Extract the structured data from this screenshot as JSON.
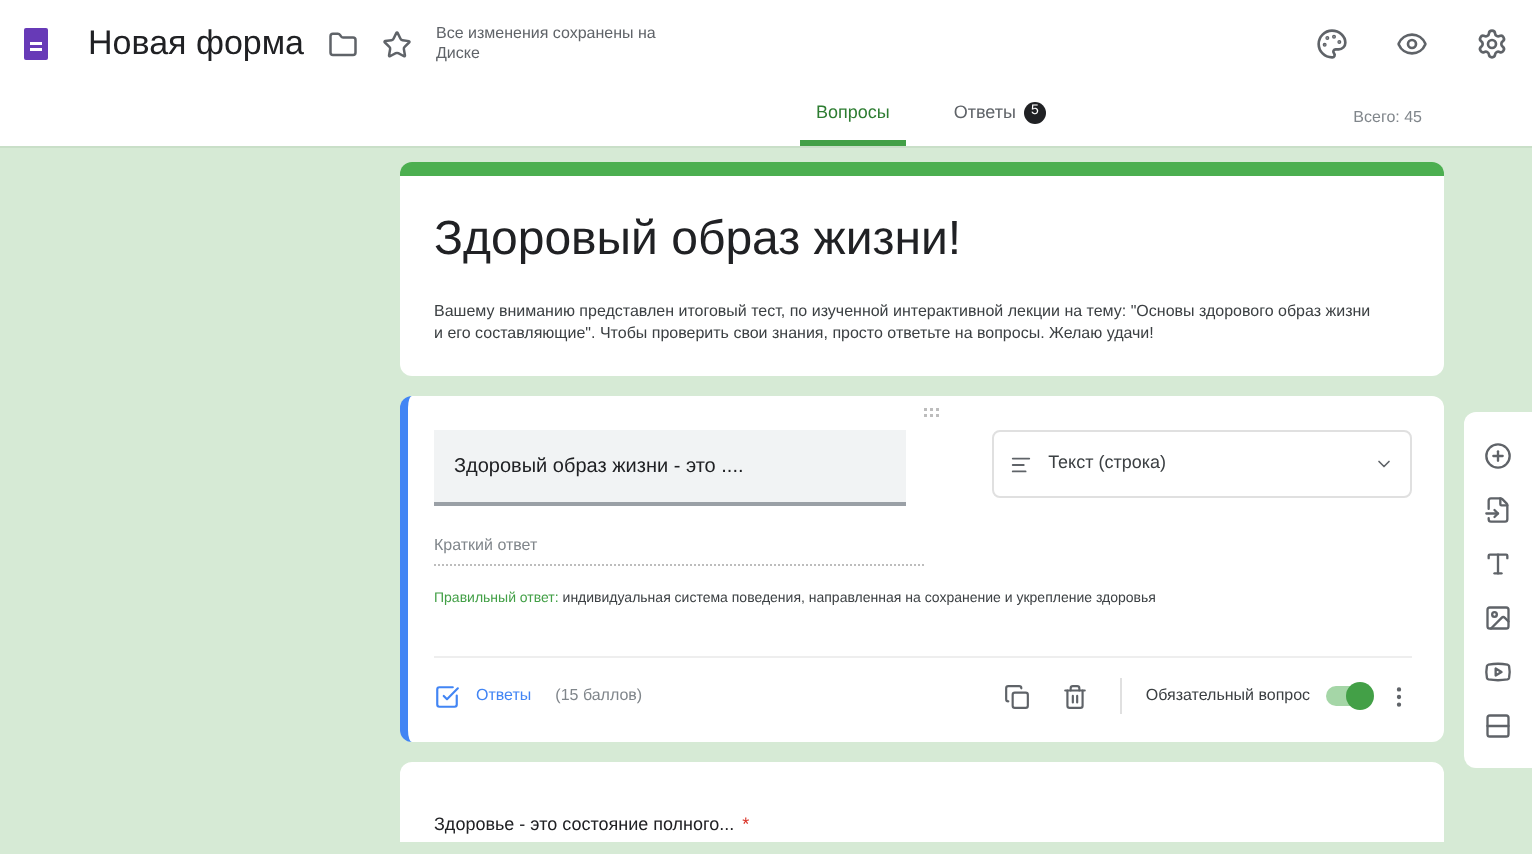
{
  "header": {
    "title": "Новая форма",
    "save_status": "Все изменения сохранены на Диске"
  },
  "tabs": [
    {
      "label": "Вопросы",
      "selected": true
    },
    {
      "label": "Ответы",
      "selected": false,
      "badge": "5"
    }
  ],
  "total": "Всего: 45",
  "form": {
    "title": "Здоровый образ жизни!",
    "description": "Вашему вниманию представлен итоговый тест, по изученной интерактивной лекции на тему: \"Основы здорового образ жизни и его составляющие\". Чтобы проверить свои знания, просто ответьте на вопросы. Желаю удачи!"
  },
  "question": {
    "title": "Здоровый образ жизни - это ....",
    "type": "Текст (строка)",
    "answer_placeholder": "Краткий ответ",
    "correct_label": "Правильный ответ:",
    "correct_answer": "индивидуальная система поведения, направленная на сохранение и укрепление здоровья",
    "answers_link": "Ответы",
    "points": "(15 баллов)",
    "required_label": "Обязательный вопрос",
    "required": true
  },
  "next_question": {
    "title": "Здоровье - это состояние полного...",
    "required_mark": "*"
  }
}
